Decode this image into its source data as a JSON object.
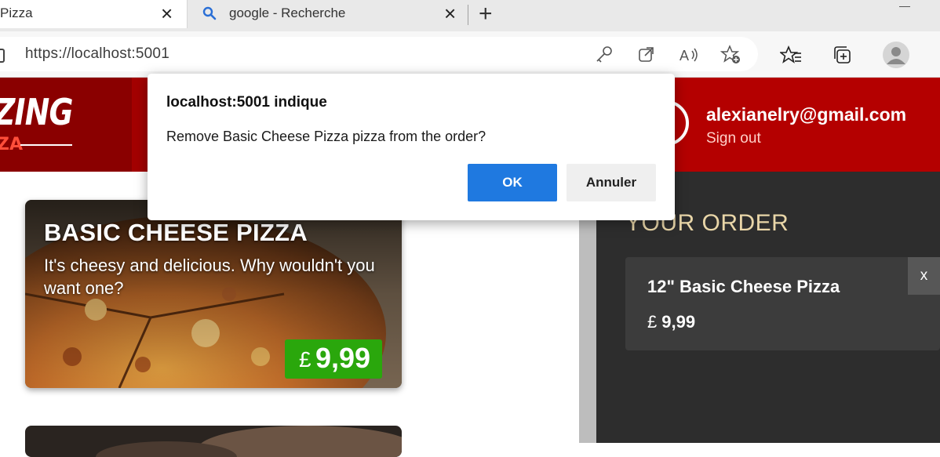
{
  "browser": {
    "tabs": [
      {
        "label": "Pizza",
        "active": true
      },
      {
        "label": "google - Recherche",
        "active": false
      }
    ],
    "url": "https://localhost:5001",
    "new_tab_icon": "plus-icon",
    "toolbar_icons": [
      "key-icon",
      "open-external-icon",
      "read-aloud-icon",
      "add-favorite-icon",
      "favorites-icon",
      "collections-icon",
      "profile-avatar-icon"
    ]
  },
  "header": {
    "brand": "ZING",
    "brand_sub": "ZA",
    "user_email": "alexianelry@gmail.com",
    "signout_label": "Sign out"
  },
  "pizza_card": {
    "name": "BASIC CHEESE PIZZA",
    "description": "It's cheesy and delicious. Why wouldn't you want one?",
    "currency": "£",
    "price": "9,99"
  },
  "order": {
    "title": "YOUR ORDER",
    "items": [
      {
        "name": "12\" Basic Cheese Pizza",
        "currency": "£",
        "price": "9,99",
        "remove_label": "x"
      }
    ]
  },
  "dialog": {
    "title": "localhost:5001 indique",
    "message": "Remove Basic Cheese Pizza pizza from the order?",
    "ok_label": "OK",
    "cancel_label": "Annuler"
  },
  "colors": {
    "header_red": "#b40000",
    "price_green": "#2aa70c",
    "ok_blue": "#1f79e0",
    "sidebar_dark": "#2d2d2d",
    "order_title_gold": "#e9d6a8"
  }
}
